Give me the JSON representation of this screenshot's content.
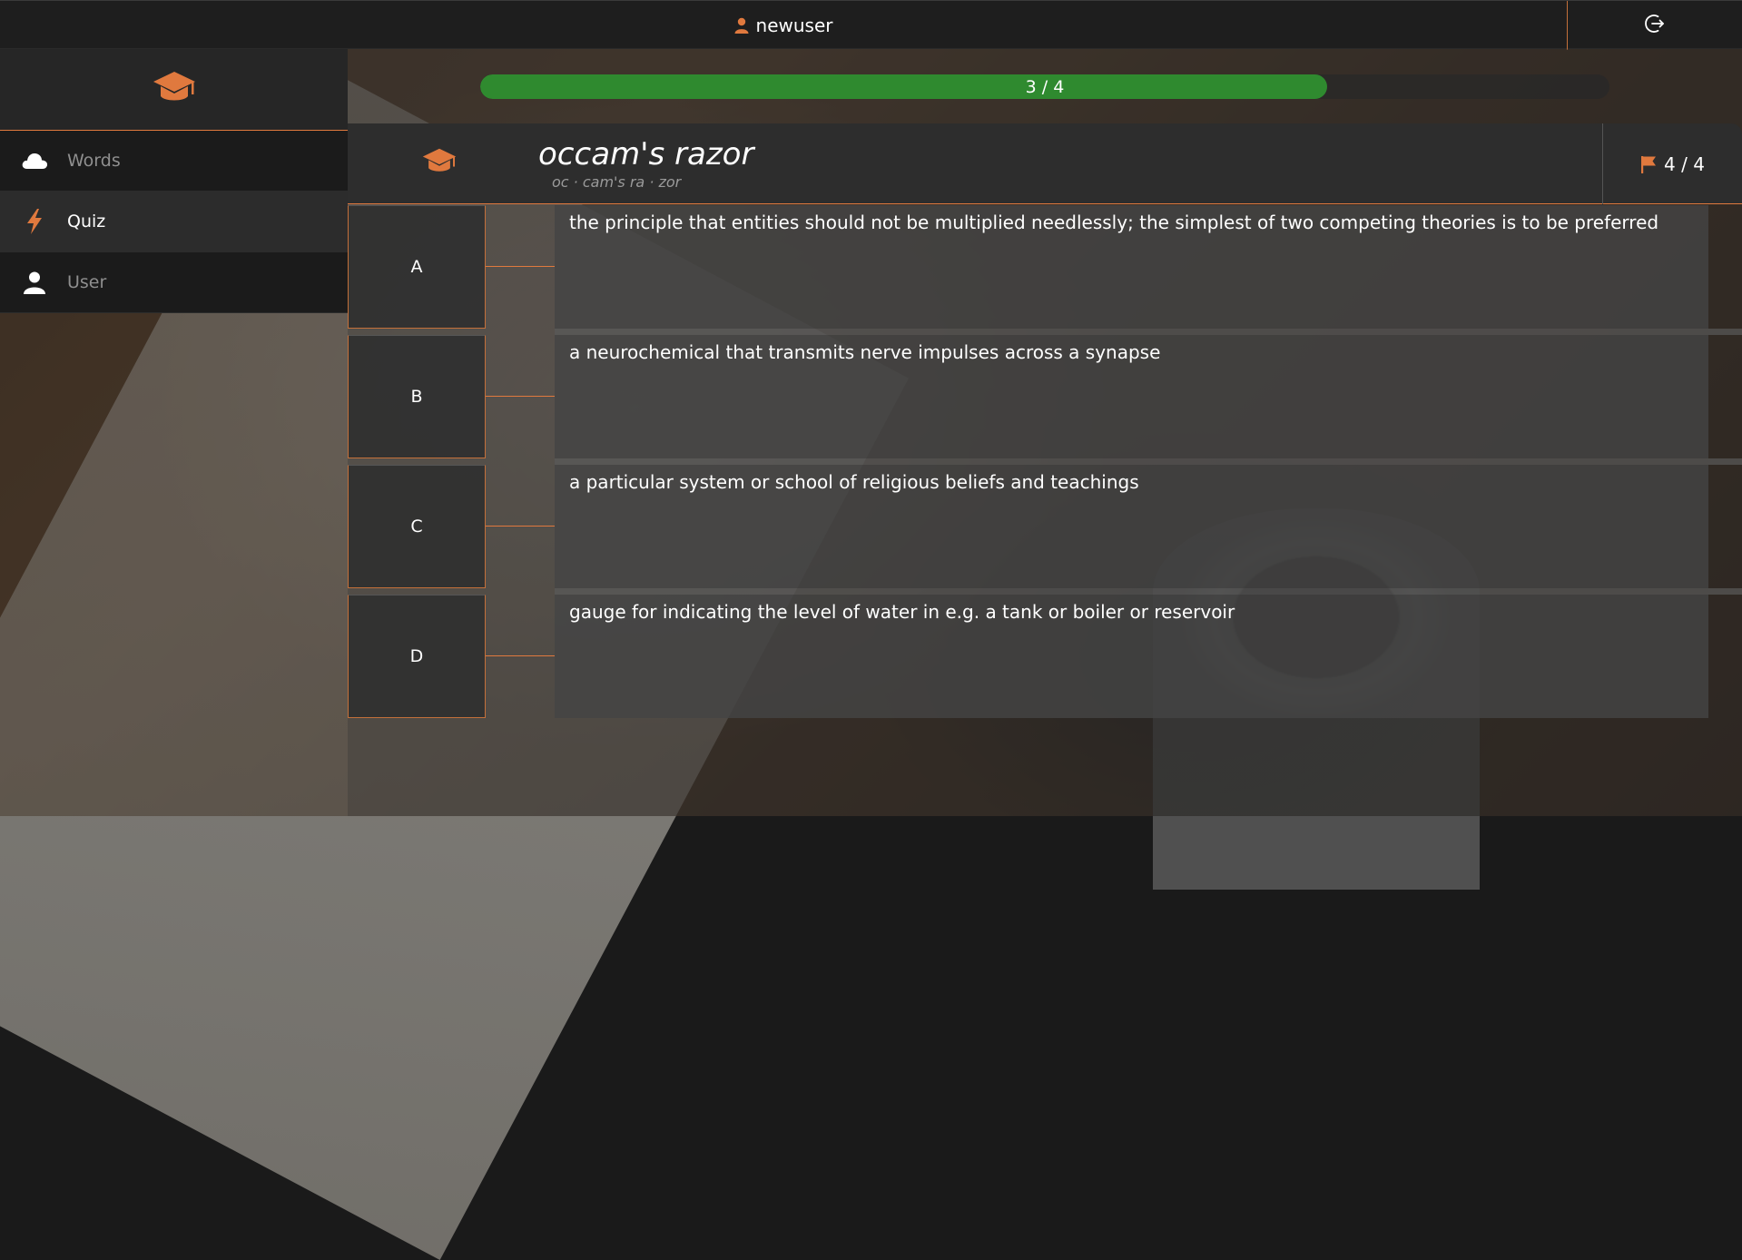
{
  "topbar": {
    "username": "newuser",
    "user_icon": "user-icon",
    "logout_icon": "logout-icon"
  },
  "sidebar": {
    "logo_icon": "graduation-cap-icon",
    "items": [
      {
        "label": "Words",
        "icon": "cloud-icon",
        "active": false
      },
      {
        "label": "Quiz",
        "icon": "lightning-icon",
        "active": true
      },
      {
        "label": "User",
        "icon": "user-icon",
        "active": false
      }
    ]
  },
  "quiz": {
    "progress_text": "3 / 4",
    "progress_fraction": 0.75,
    "word": "occam's razor",
    "syllables": "oc · cam's ra · zor",
    "counter": "4 / 4",
    "counter_icon": "flag-icon",
    "header_icon": "graduation-cap-icon",
    "options": [
      {
        "letter": "A",
        "text": "the principle that entities should not be multiplied needlessly; the simplest of two competing theories is to be preferred"
      },
      {
        "letter": "B",
        "text": "a neurochemical that transmits nerve impulses across a synapse"
      },
      {
        "letter": "C",
        "text": "a particular system or school of religious beliefs and teachings"
      },
      {
        "letter": "D",
        "text": "gauge for indicating the level of water in e.g. a tank or boiler or reservoir"
      }
    ]
  },
  "colors": {
    "accent": "#e0793e",
    "progress": "#2f8a2f",
    "bar": "#1e1e1e"
  }
}
